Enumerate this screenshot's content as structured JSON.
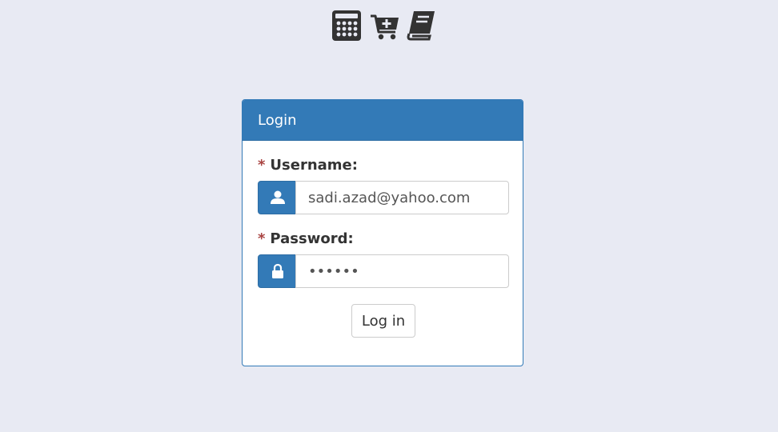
{
  "top_icons": [
    "calculator-icon",
    "cart-plus-icon",
    "book-icon"
  ],
  "panel": {
    "title": "Login"
  },
  "username": {
    "required_mark": "*",
    "label": "Username:",
    "value": "sadi.azad@yahoo.com",
    "icon": "user-icon"
  },
  "password": {
    "required_mark": "*",
    "label": "Password:",
    "value": "123456",
    "icon": "lock-icon"
  },
  "submit": {
    "label": "Log in"
  },
  "colors": {
    "background": "#e8eaf3",
    "primary": "#337ab7",
    "required": "#a94442",
    "icon_dark": "#333333"
  }
}
